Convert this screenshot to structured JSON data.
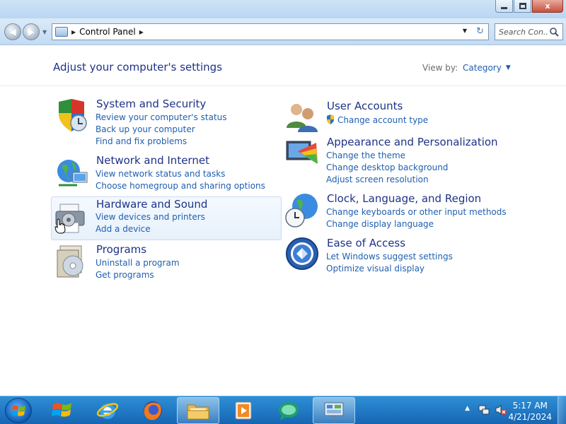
{
  "window": {
    "min_icon": "minimize-icon",
    "max_icon": "restore-icon",
    "close_label": "x"
  },
  "nav": {
    "back_icon": "back-arrow-icon",
    "forward_icon": "forward-arrow-icon"
  },
  "address": {
    "path": "Control Panel",
    "refresh_icon": "refresh-icon"
  },
  "search": {
    "placeholder": "Search Con..."
  },
  "header": {
    "title": "Adjust your computer's settings",
    "view_by_label": "View by:",
    "view_by_value": "Category"
  },
  "categories": [
    {
      "title": "System and Security",
      "icon": "shield-icon",
      "links": [
        "Review your computer's status",
        "Back up your computer",
        "Find and fix problems"
      ]
    },
    {
      "title": "Network and Internet",
      "icon": "network-globe-icon",
      "links": [
        "View network status and tasks",
        "Choose homegroup and sharing options"
      ]
    },
    {
      "title": "Hardware and Sound",
      "icon": "printer-icon",
      "links": [
        "View devices and printers",
        "Add a device"
      ]
    },
    {
      "title": "Programs",
      "icon": "programs-disk-icon",
      "links": [
        "Uninstall a program",
        "Get programs"
      ]
    },
    {
      "title": "User Accounts",
      "icon": "users-icon",
      "links": [
        "Change account type"
      ]
    },
    {
      "title": "Appearance and Personalization",
      "icon": "monitor-palette-icon",
      "links": [
        "Change the theme",
        "Change desktop background",
        "Adjust screen resolution"
      ]
    },
    {
      "title": "Clock, Language, and Region",
      "icon": "clock-globe-icon",
      "links": [
        "Change keyboards or other input methods",
        "Change display language"
      ]
    },
    {
      "title": "Ease of Access",
      "icon": "ease-of-access-icon",
      "links": [
        "Let Windows suggest settings",
        "Optimize visual display"
      ]
    }
  ],
  "taskbar": {
    "items": [
      "windows-flag-icon",
      "internet-explorer-icon",
      "firefox-icon",
      "file-explorer-icon",
      "media-player-icon",
      "chat-app-icon",
      "control-panel-icon"
    ],
    "time": "5:17 AM",
    "date": "4/21/2024"
  },
  "colors": {
    "heading": "#1e3287",
    "link": "#1f5fb0",
    "taskbar": "#1f78c8"
  }
}
